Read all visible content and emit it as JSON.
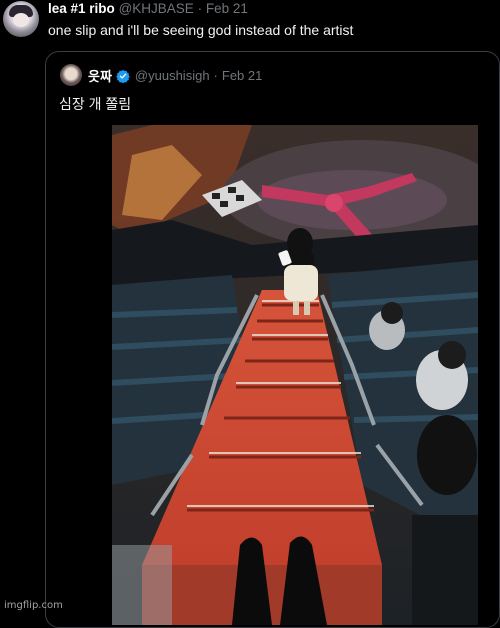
{
  "tweet": {
    "display_name": "lea #1 ribo",
    "handle": "@KHJBASE",
    "separator": "·",
    "date": "Feb 21",
    "text": "one slip and i'll be seeing god instead of the artist"
  },
  "quoted_tweet": {
    "display_name": "읏짜",
    "handle": "@yuushisigh",
    "separator": "·",
    "date": "Feb 21",
    "text": "심장 개 쫄림",
    "verified_color": "#1d9bf0"
  },
  "photo": {
    "description_icon": "stadium-stairs-photo"
  },
  "watermark": {
    "text": "imgflip.com"
  }
}
